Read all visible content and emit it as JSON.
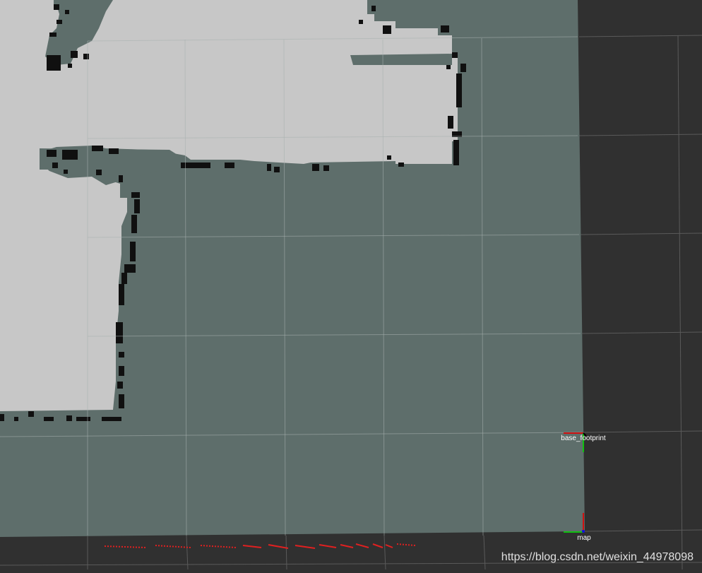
{
  "colors": {
    "background": "#303030",
    "unknown": "#5e6e6b",
    "free": "#c7c7c7",
    "occupied": "#101010",
    "grid": "#9a9a9a",
    "laser": "#e02020",
    "axis_x": "#d01010",
    "axis_y": "#10c010",
    "axis_z": "#1010e0",
    "label": "#ffffff",
    "watermark": "#e0e0e0"
  },
  "frames": {
    "base_footprint": "base_footprint",
    "map": "map"
  },
  "watermark": "https://blog.csdn.net/weixin_44978098",
  "icons": {
    "frame_axes": "tf-axes-icon"
  }
}
